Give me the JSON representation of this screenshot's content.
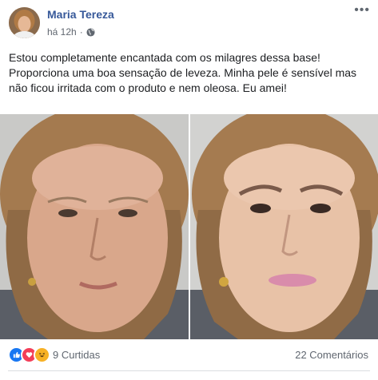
{
  "post": {
    "author": "Maria Tereza",
    "time": "há 12h",
    "separator": "·",
    "privacy_icon": "globe-icon",
    "more_icon": "more-options-icon",
    "more_glyph": "•••",
    "text": "Estou completamente encantada com os milagres dessa base! Proporciona uma boa sensação de leveza. Minha pele é sensível mas não ficou irritada com o produto e nem oleosa. Eu amei!"
  },
  "reactions": {
    "icons": [
      "like-icon",
      "love-icon",
      "haha-icon"
    ],
    "likes": "9 Curtidas",
    "comments": "22 Comentários"
  },
  "colors": {
    "author": "#365899",
    "like": "#1877f2",
    "love": "#f33e58",
    "haha": "#f7b125"
  }
}
